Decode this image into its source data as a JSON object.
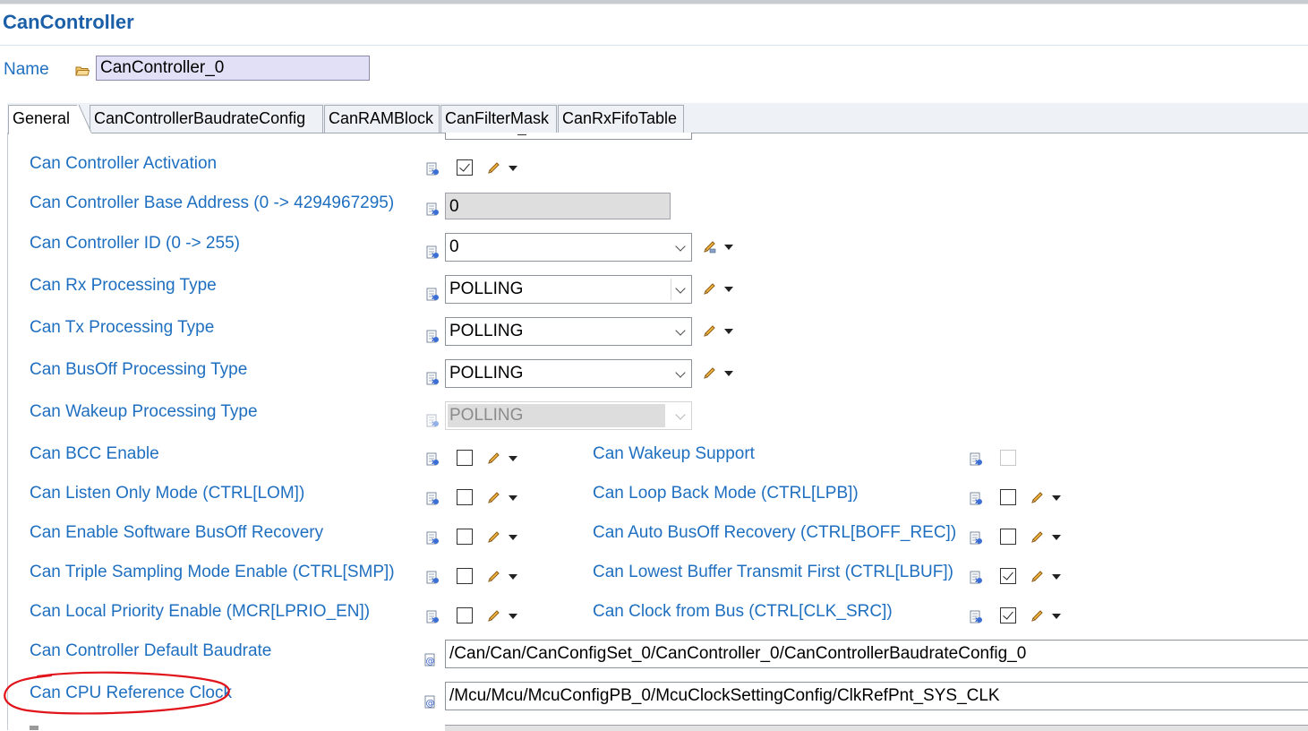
{
  "header": {
    "title": "CanController"
  },
  "name_field": {
    "label": "Name",
    "value": "CanController_0"
  },
  "tabs": [
    {
      "label": "General",
      "active": true
    },
    {
      "label": "CanControllerBaudrateConfig",
      "active": false
    },
    {
      "label": "CanRAMBlock",
      "active": false
    },
    {
      "label": "CanFilterMask",
      "active": false
    },
    {
      "label": "CanRxFifoTable",
      "active": false
    }
  ],
  "general": {
    "activation": {
      "label": "Can Controller Activation",
      "checked": true
    },
    "base_address": {
      "label": "Can Controller Base Address (0 -> 4294967295)",
      "value": "0"
    },
    "controller_id": {
      "label": "Can Controller ID (0 -> 255)",
      "value": "0"
    },
    "rx_processing": {
      "label": "Can Rx Processing Type",
      "value": "POLLING"
    },
    "tx_processing": {
      "label": "Can Tx Processing Type",
      "value": "POLLING"
    },
    "busoff_processing": {
      "label": "Can BusOff Processing Type",
      "value": "POLLING"
    },
    "wakeup_processing": {
      "label": "Can Wakeup Processing Type",
      "value": "POLLING",
      "disabled": true
    },
    "bcc_enable": {
      "label": "Can BCC Enable",
      "checked": false
    },
    "wakeup_support": {
      "label": "Can Wakeup Support",
      "checked": false,
      "disabled": true
    },
    "listen_only": {
      "label": "Can Listen Only Mode (CTRL[LOM])",
      "checked": false
    },
    "loop_back": {
      "label": "Can Loop Back Mode (CTRL[LPB])",
      "checked": false
    },
    "sw_busoff_recovery": {
      "label": "Can Enable Software BusOff Recovery",
      "checked": false
    },
    "auto_busoff_recovery": {
      "label": "Can Auto BusOff Recovery (CTRL[BOFF_REC])",
      "checked": false
    },
    "triple_sampling": {
      "label": "Can Triple Sampling Mode Enable (CTRL[SMP])",
      "checked": false
    },
    "lowest_buffer_first": {
      "label": "Can Lowest Buffer Transmit First (CTRL[LBUF])",
      "checked": true
    },
    "local_priority": {
      "label": "Can Local Priority Enable (MCR[LPRIO_EN])",
      "checked": false
    },
    "clock_from_bus": {
      "label": "Can Clock from Bus (CTRL[CLK_SRC])",
      "checked": true
    },
    "default_baudrate": {
      "label": "Can Controller Default Baudrate",
      "value": "/Can/Can/CanConfigSet_0/CanController_0/CanControllerBaudrateConfig_0"
    },
    "cpu_ref_clock": {
      "label": "Can CPU Reference Clock",
      "value": "/Mcu/Mcu/McuConfigPB_0/McuClockSettingConfig/ClkRefPnt_SYS_CLK"
    }
  },
  "colors": {
    "label_blue": "#1f6fc0",
    "title_blue": "#1a5fa8",
    "annotation_red": "#e0141a",
    "name_input_bg": "#e2e0f6"
  },
  "icons": {
    "row_prefix": "config-class-icon",
    "edit": "pencil-icon",
    "menu": "dropdown-caret-icon",
    "reference": "reference-link-icon"
  }
}
